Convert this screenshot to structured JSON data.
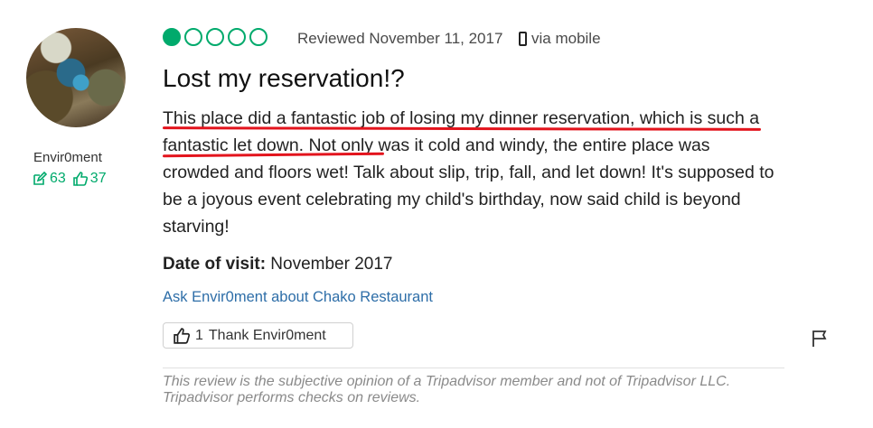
{
  "reviewer": {
    "username": "Envir0ment",
    "contributions": "63",
    "helpful_votes": "37"
  },
  "review": {
    "rating_filled": 1,
    "rating_total": 5,
    "reviewed_date": "Reviewed November 11, 2017",
    "via": "via mobile",
    "title": "Lost my reservation!?",
    "body_highlight_1": "This place did a fantastic job of losing my dinner reservation, which is",
    "body_highlight_2": "such a fantastic let down.",
    "body_rest": " Not only was it cold and windy, the entire place was crowded and floors wet! Talk about slip, trip, fall, and let down! It's supposed to be a joyous event celebrating my child's birthday, now said child is beyond starving!",
    "date_of_visit_label": "Date of visit:",
    "date_of_visit_value": " November 2017",
    "ask_link": "Ask Envir0ment about Chako Restaurant",
    "thank_count": "1",
    "thank_label": "Thank Envir0ment",
    "disclaimer": "This review is the subjective opinion of a Tripadvisor member and not of Tripadvisor LLC. Tripadvisor performs checks on reviews."
  },
  "colors": {
    "accent": "#00aa6c",
    "annotation": "#e3141d",
    "link": "#2e6ea8"
  }
}
